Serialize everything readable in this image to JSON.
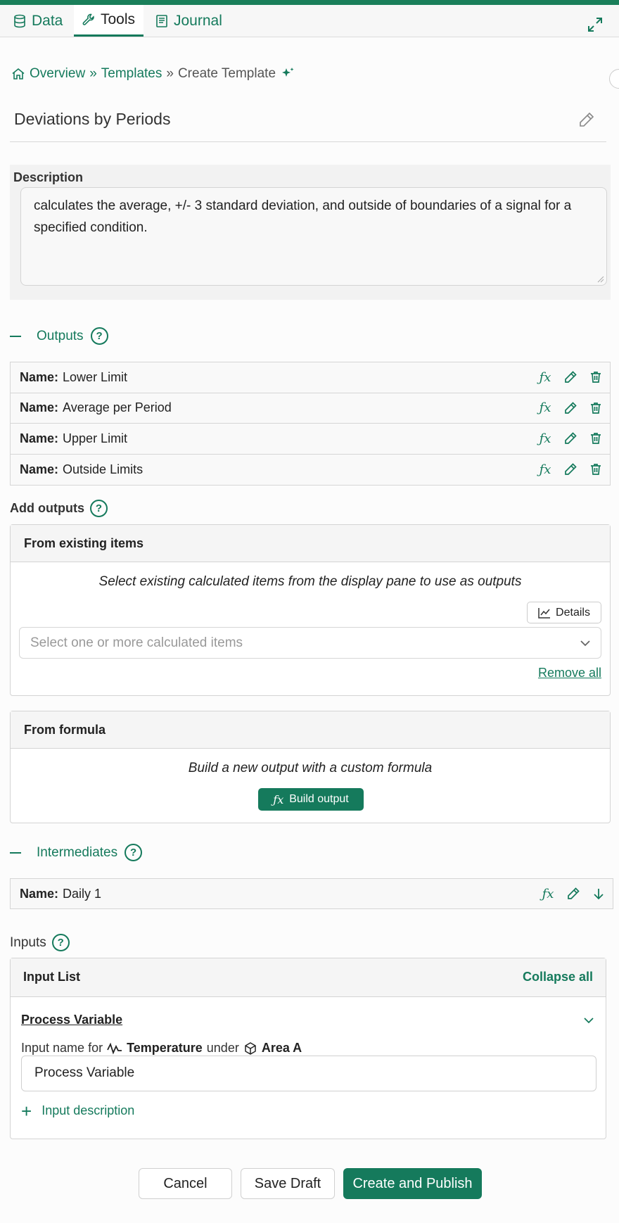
{
  "tabs": [
    {
      "label": "Data",
      "icon": "database-icon",
      "active": false
    },
    {
      "label": "Tools",
      "icon": "wrench-icon",
      "active": true
    },
    {
      "label": "Journal",
      "icon": "journal-icon",
      "active": false
    }
  ],
  "breadcrumb": {
    "home": "Overview",
    "sep1": "»",
    "templates": "Templates",
    "sep2": "»",
    "current": "Create Template"
  },
  "template": {
    "title": "Deviations by Periods",
    "description_label": "Description",
    "description": "calculates the average, +/- 3 standard deviation, and outside of boundaries of a signal for a specified condition."
  },
  "outputs": {
    "heading": "Outputs",
    "name_prefix": "Name:",
    "items": [
      "Lower Limit",
      "Average per Period",
      "Upper Limit",
      "Outside Limits"
    ]
  },
  "add_outputs": {
    "label": "Add outputs",
    "existing": {
      "title": "From existing items",
      "subtitle": "Select existing calculated items from the display pane to use as outputs",
      "details_label": "Details",
      "select_placeholder": "Select one or more calculated items",
      "remove_all": "Remove all"
    },
    "formula": {
      "title": "From formula",
      "subtitle": "Build a new output with a custom formula",
      "build_label": "Build output"
    }
  },
  "intermediates": {
    "heading": "Intermediates",
    "name_prefix": "Name:",
    "items": [
      "Daily 1"
    ]
  },
  "inputs": {
    "label": "Inputs",
    "list_title": "Input List",
    "collapse_all": "Collapse all",
    "item_title": "Process Variable",
    "input_for_prefix": "Input name for",
    "signal": "Temperature",
    "under": "under",
    "asset": "Area A",
    "value": "Process Variable",
    "add_description": "Input description"
  },
  "footer": {
    "cancel": "Cancel",
    "save_draft": "Save Draft",
    "publish": "Create and Publish"
  },
  "colors": {
    "accent": "#157a5c"
  }
}
